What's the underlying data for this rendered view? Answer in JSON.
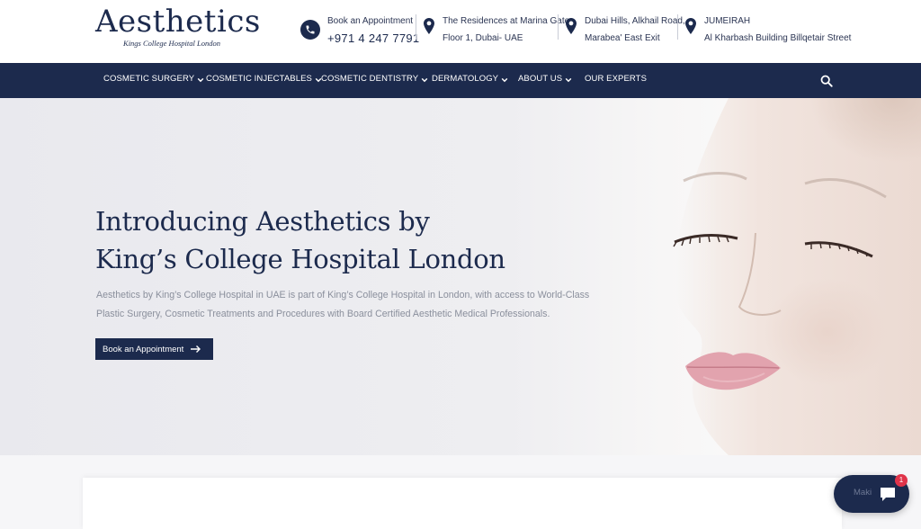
{
  "logo": {
    "name": "Aesthetics",
    "tagline": "Kings College Hospital London"
  },
  "contacts": {
    "appointment": {
      "label": "Book an Appointment",
      "phone": "+971 4 247 7791"
    },
    "marina": {
      "line1": "The Residences at Marina Gate",
      "line2": "Floor 1, Dubai- UAE"
    },
    "hills": {
      "line1": "Dubai Hills, Alkhail Road,",
      "line2": "Marabea' East Exit"
    },
    "jumeirah": {
      "line1": "JUMEIRAH",
      "line2": "Al Kharbash Building Billqetair Street"
    }
  },
  "nav": {
    "items": [
      {
        "label": "COSMETIC SURGERY"
      },
      {
        "label": "COSMETIC INJECTABLES"
      },
      {
        "label": "COSMETIC DENTISTRY"
      },
      {
        "label": "DERMATOLOGY"
      },
      {
        "label": "ABOUT US"
      },
      {
        "label": "OUR EXPERTS"
      }
    ]
  },
  "hero": {
    "title_line1": "Introducing Aesthetics by",
    "title_line2": "King’s College Hospital London",
    "description": "Aesthetics by King’s College Hospital in UAE is part of King’s College Hospital in London, with access to World-Class Plastic Surgery, Cosmetic Treatments and Procedures with Board Certified Aesthetic Medical Professionals.",
    "button_label": "Book an Appointment"
  },
  "chat": {
    "label": "Maki",
    "badge": "1"
  },
  "colors": {
    "brand_navy": "#1c2a4d",
    "badge_red": "#e0344a",
    "muted_text": "#8a8f9c"
  }
}
